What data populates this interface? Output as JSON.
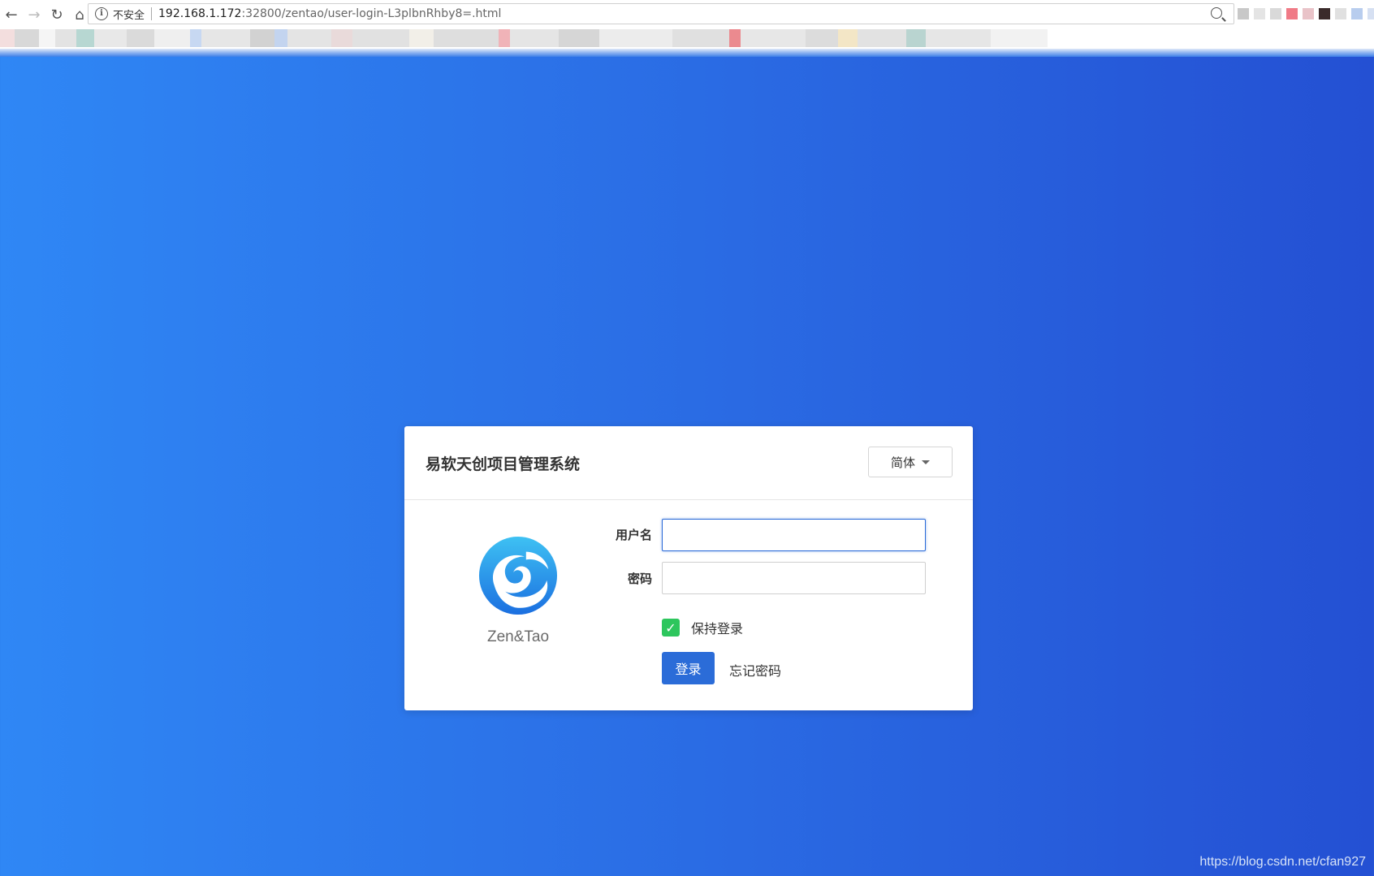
{
  "browser": {
    "security_label": "不安全",
    "url_host": "192.168.1.172",
    "url_rest": ":32800/zentao/user-login-L3plbnRhby8=.html",
    "info_icon": "info-icon",
    "back_icon": "←",
    "forward_icon": "→",
    "reload_icon": "↻",
    "home_icon": "⌂"
  },
  "login": {
    "title": "易软天创项目管理系统",
    "language_button": "简体",
    "logo_text": "Zen&Tao",
    "username_label": "用户名",
    "username_value": "",
    "password_label": "密码",
    "password_value": "",
    "remember_label": "保持登录",
    "remember_checked": true,
    "submit_label": "登录",
    "forgot_label": "忘记密码"
  },
  "watermark": "https://blog.csdn.net/cfan927",
  "colors": {
    "primary": "#2b6cd8",
    "checkbox": "#2dc65d",
    "background_start": "#2f87f5",
    "background_end": "#2450d3"
  }
}
